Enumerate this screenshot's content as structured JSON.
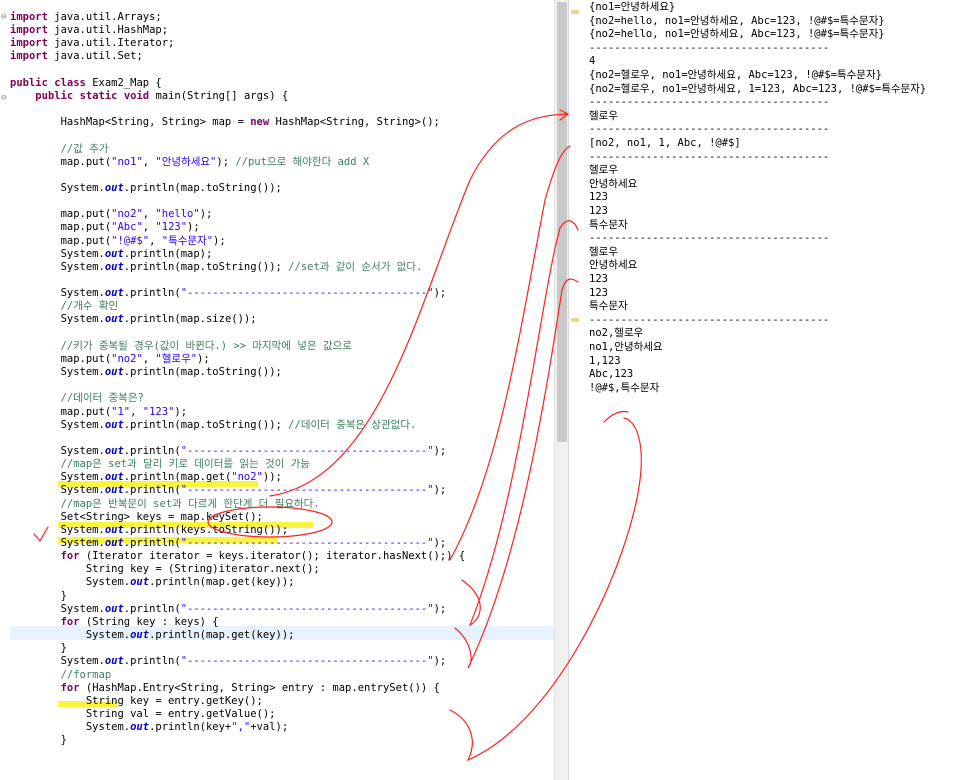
{
  "editor": {
    "code_lines": [
      [
        [
          "kw",
          "import"
        ],
        [
          "t",
          " java.util.Arrays;"
        ]
      ],
      [
        [
          "kw",
          "import"
        ],
        [
          "t",
          " java.util.HashMap;"
        ]
      ],
      [
        [
          "kw",
          "import"
        ],
        [
          "t",
          " java.util.Iterator;"
        ]
      ],
      [
        [
          "kw",
          "import"
        ],
        [
          "t",
          " java.util.Set;"
        ]
      ],
      [
        [
          "t",
          ""
        ]
      ],
      [
        [
          "kw",
          "public"
        ],
        [
          "t",
          " "
        ],
        [
          "kw",
          "class"
        ],
        [
          "t",
          " Exam2_Map {"
        ]
      ],
      [
        [
          "t",
          "    "
        ],
        [
          "kw",
          "public"
        ],
        [
          "t",
          " "
        ],
        [
          "kw",
          "static"
        ],
        [
          "t",
          " "
        ],
        [
          "kw",
          "void"
        ],
        [
          "t",
          " main(String[] args) {"
        ]
      ],
      [
        [
          "t",
          ""
        ]
      ],
      [
        [
          "t",
          "        HashMap<String, String> map = "
        ],
        [
          "kw",
          "new"
        ],
        [
          "t",
          " HashMap<String, String>();"
        ]
      ],
      [
        [
          "t",
          ""
        ]
      ],
      [
        [
          "cm",
          "        //값 추가"
        ]
      ],
      [
        [
          "t",
          "        map.put("
        ],
        [
          "str",
          "\"no1\""
        ],
        [
          "t",
          ", "
        ],
        [
          "str",
          "\"안녕하세요\""
        ],
        [
          "t",
          "); "
        ],
        [
          "cm",
          "//put으로 해야한다 add X"
        ]
      ],
      [
        [
          "t",
          ""
        ]
      ],
      [
        [
          "t",
          "        System."
        ],
        [
          "fld",
          "out"
        ],
        [
          "t",
          ".println(map.toString());"
        ]
      ],
      [
        [
          "t",
          ""
        ]
      ],
      [
        [
          "t",
          "        map.put("
        ],
        [
          "str",
          "\"no2\""
        ],
        [
          "t",
          ", "
        ],
        [
          "str",
          "\"hello\""
        ],
        [
          "t",
          ");"
        ]
      ],
      [
        [
          "t",
          "        map.put("
        ],
        [
          "str",
          "\"Abc\""
        ],
        [
          "t",
          ", "
        ],
        [
          "str",
          "\"123\""
        ],
        [
          "t",
          ");"
        ]
      ],
      [
        [
          "t",
          "        map.put("
        ],
        [
          "str",
          "\"!@#$\""
        ],
        [
          "t",
          ", "
        ],
        [
          "str",
          "\"특수문자\""
        ],
        [
          "t",
          ");"
        ]
      ],
      [
        [
          "t",
          "        System."
        ],
        [
          "fld",
          "out"
        ],
        [
          "t",
          ".println(map);"
        ]
      ],
      [
        [
          "t",
          "        System."
        ],
        [
          "fld",
          "out"
        ],
        [
          "t",
          ".println(map.toString()); "
        ],
        [
          "cm",
          "//set과 같이 순서가 없다."
        ]
      ],
      [
        [
          "t",
          ""
        ]
      ],
      [
        [
          "t",
          "        System."
        ],
        [
          "fld",
          "out"
        ],
        [
          "t",
          ".println("
        ],
        [
          "str",
          "\"--------------------------------------\""
        ],
        [
          "t",
          ");"
        ]
      ],
      [
        [
          "cm",
          "        //개수 확인"
        ]
      ],
      [
        [
          "t",
          "        System."
        ],
        [
          "fld",
          "out"
        ],
        [
          "t",
          ".println(map.size());"
        ]
      ],
      [
        [
          "t",
          ""
        ]
      ],
      [
        [
          "cm",
          "        //키가 중복될 경우(값이 바뀐다.) >> 마지막에 넣은 값으로"
        ]
      ],
      [
        [
          "t",
          "        map.put("
        ],
        [
          "str",
          "\"no2\""
        ],
        [
          "t",
          ", "
        ],
        [
          "str",
          "\"헬로우\""
        ],
        [
          "t",
          ");"
        ]
      ],
      [
        [
          "t",
          "        System."
        ],
        [
          "fld",
          "out"
        ],
        [
          "t",
          ".println(map.toString());"
        ]
      ],
      [
        [
          "t",
          ""
        ]
      ],
      [
        [
          "cm",
          "        //데이터 중복은?"
        ]
      ],
      [
        [
          "t",
          "        map.put("
        ],
        [
          "str",
          "\"1\""
        ],
        [
          "t",
          ", "
        ],
        [
          "str",
          "\"123\""
        ],
        [
          "t",
          ");"
        ]
      ],
      [
        [
          "t",
          "        System."
        ],
        [
          "fld",
          "out"
        ],
        [
          "t",
          ".println(map.toString()); "
        ],
        [
          "cm",
          "//데이터 중복은 상관없다."
        ]
      ],
      [
        [
          "t",
          ""
        ]
      ],
      [
        [
          "t",
          "        System."
        ],
        [
          "fld",
          "out"
        ],
        [
          "t",
          ".println("
        ],
        [
          "str",
          "\"--------------------------------------\""
        ],
        [
          "t",
          ");"
        ]
      ],
      [
        [
          "cm",
          "        //map은 set과 달리 키로 데이터를 읽는 것이 가능"
        ]
      ],
      [
        [
          "t",
          "        System."
        ],
        [
          "fld",
          "out"
        ],
        [
          "t",
          ".println(map.get("
        ],
        [
          "str",
          "\"no2\""
        ],
        [
          "t",
          "));"
        ]
      ],
      [
        [
          "t",
          "        System."
        ],
        [
          "fld",
          "out"
        ],
        [
          "t",
          ".println("
        ],
        [
          "str",
          "\"--------------------------------------\""
        ],
        [
          "t",
          ");"
        ]
      ],
      [
        [
          "cm",
          "        //map은 반복문이 set과 다르게 한단계 더 필요하다."
        ]
      ],
      [
        [
          "t",
          "        Set<String> keys = map.keySet();"
        ]
      ],
      [
        [
          "t",
          "        System."
        ],
        [
          "fld",
          "out"
        ],
        [
          "t",
          ".println(keys.toString());"
        ]
      ],
      [
        [
          "t",
          "        System."
        ],
        [
          "fld",
          "out"
        ],
        [
          "t",
          ".println("
        ],
        [
          "str",
          "\"--------------------------------------\""
        ],
        [
          "t",
          ");"
        ]
      ],
      [
        [
          "t",
          "        "
        ],
        [
          "kw",
          "for"
        ],
        [
          "t",
          " (Iterator iterator = keys.iterator(); iterator.hasNext();) {"
        ]
      ],
      [
        [
          "t",
          "            String key = (String)iterator.next();"
        ]
      ],
      [
        [
          "t",
          "            System."
        ],
        [
          "fld",
          "out"
        ],
        [
          "t",
          ".println(map.get(key));"
        ]
      ],
      [
        [
          "t",
          "        }"
        ]
      ],
      [
        [
          "t",
          "        System."
        ],
        [
          "fld",
          "out"
        ],
        [
          "t",
          ".println("
        ],
        [
          "str",
          "\"--------------------------------------\""
        ],
        [
          "t",
          ");"
        ]
      ],
      [
        [
          "t",
          "        "
        ],
        [
          "kw",
          "for"
        ],
        [
          "t",
          " (String key : keys) {"
        ]
      ],
      [
        [
          "t",
          "            System."
        ],
        [
          "fld",
          "out"
        ],
        [
          "t",
          ".println(map.get(key));"
        ]
      ],
      [
        [
          "t",
          "        }"
        ]
      ],
      [
        [
          "t",
          "        System."
        ],
        [
          "fld",
          "out"
        ],
        [
          "t",
          ".println("
        ],
        [
          "str",
          "\"--------------------------------------\""
        ],
        [
          "t",
          ");"
        ]
      ],
      [
        [
          "cm",
          "        //formap"
        ]
      ],
      [
        [
          "t",
          "        "
        ],
        [
          "kw",
          "for"
        ],
        [
          "t",
          " (HashMap.Entry<String, String> entry : map.entrySet()) {"
        ]
      ],
      [
        [
          "t",
          "            String key = entry.getKey();"
        ]
      ],
      [
        [
          "t",
          "            String val = entry.getValue();"
        ]
      ],
      [
        [
          "t",
          "            System."
        ],
        [
          "fld",
          "out"
        ],
        [
          "t",
          ".println(key+"
        ],
        [
          "str",
          "\",\""
        ],
        [
          "t",
          "+val);"
        ]
      ],
      [
        [
          "t",
          "        }"
        ]
      ]
    ]
  },
  "console": {
    "lines": [
      "{no1=안녕하세요}",
      "{no2=hello, no1=안녕하세요, Abc=123, !@#$=특수문자}",
      "{no2=hello, no1=안녕하세요, Abc=123, !@#$=특수문자}",
      "--------------------------------------",
      "4",
      "{no2=헬로우, no1=안녕하세요, Abc=123, !@#$=특수문자}",
      "{no2=헬로우, no1=안녕하세요, 1=123, Abc=123, !@#$=특수문자}",
      "--------------------------------------",
      "헬로우",
      "--------------------------------------",
      "[no2, no1, 1, Abc, !@#$]",
      "--------------------------------------",
      "헬로우",
      "안녕하세요",
      "123",
      "123",
      "특수문자",
      "--------------------------------------",
      "헬로우",
      "안녕하세요",
      "123",
      "123",
      "특수문자",
      "--------------------------------------",
      "no2,헬로우",
      "no1,안녕하세요",
      "1,123",
      "Abc,123",
      "!@#$,특수문자"
    ]
  },
  "annotations": {
    "check_mark": "✓",
    "pen_color": "#ff2020",
    "highlight_color": "#f7f000"
  }
}
